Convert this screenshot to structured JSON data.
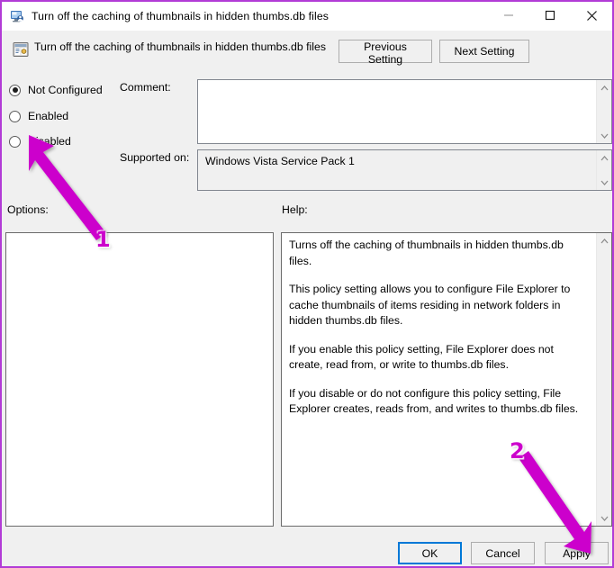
{
  "window": {
    "title": "Turn off the caching of thumbnails in hidden thumbs.db files",
    "title_icon": "computer-policy-icon",
    "border_color": "#B23BD6",
    "controls": {
      "minimize": "minimize-icon",
      "maximize": "maximize-icon",
      "close": "close-icon"
    }
  },
  "header": {
    "icon": "group-policy-setting-icon",
    "title": "Turn off the caching of thumbnails in hidden thumbs.db files",
    "previous_button": "Previous Setting",
    "next_button": "Next Setting"
  },
  "state_options": [
    {
      "label": "Not Configured",
      "selected": true
    },
    {
      "label": "Enabled",
      "selected": false
    },
    {
      "label": "Disabled",
      "selected": false
    }
  ],
  "comment": {
    "label": "Comment:",
    "value": "",
    "placeholder": ""
  },
  "supported_on": {
    "label": "Supported on:",
    "value": "Windows Vista Service Pack 1"
  },
  "options": {
    "label": "Options:",
    "content": ""
  },
  "help": {
    "label": "Help:",
    "paragraphs": [
      "Turns off the caching of thumbnails in hidden thumbs.db files.",
      "This policy setting allows you to configure File Explorer to cache thumbnails of items residing in network folders in hidden thumbs.db files.",
      "If you enable this policy setting, File Explorer does not create, read from, or write to thumbs.db files.",
      "If you disable or do not configure this policy setting, File Explorer creates, reads from, and writes to thumbs.db files."
    ]
  },
  "footer": {
    "ok": "OK",
    "cancel": "Cancel",
    "apply": "Apply",
    "focus_color": "#0078d7"
  },
  "annotations": {
    "color": "#cc00cc",
    "step_one": "1",
    "step_two": "2",
    "arrow_one_target": "disabled-radio-button",
    "arrow_two_target": "apply-button"
  }
}
